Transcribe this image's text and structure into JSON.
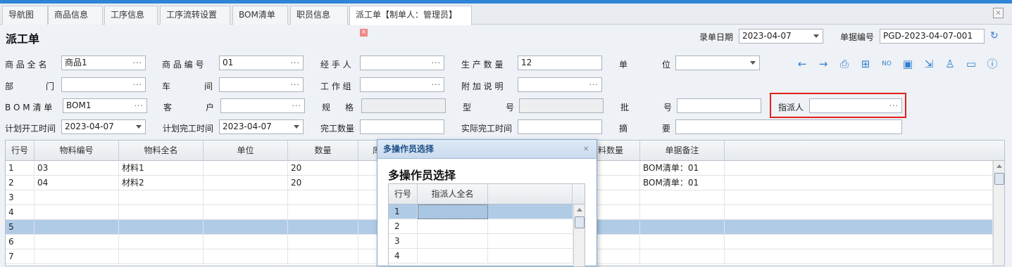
{
  "tabs": [
    {
      "label": "导航图"
    },
    {
      "label": "商品信息"
    },
    {
      "label": "工序信息"
    },
    {
      "label": "工序流转设置"
    },
    {
      "label": "BOM清单"
    },
    {
      "label": "职员信息"
    },
    {
      "label": "派工单【制单人：管理员】"
    }
  ],
  "page_title": "派工单",
  "header": {
    "date_label": "录单日期",
    "date_value": "2023-04-07",
    "doc_no_label": "单据编号",
    "doc_no_value": "PGD-2023-04-07-001"
  },
  "form": {
    "product_name_label": "商 品 全 名",
    "product_name_value": "商品1",
    "product_code_label": "商 品 编 号",
    "product_code_value": "01",
    "handler_label": "经 手 人",
    "handler_value": "",
    "qty_label": "生 产 数 量",
    "qty_value": "12",
    "unit_label_a": "单",
    "unit_label_b": "位",
    "unit_value": "",
    "dept_label_a": "部",
    "dept_label_b": "门",
    "dept_value": "",
    "workshop_label_a": "车",
    "workshop_label_b": "间",
    "workshop_value": "",
    "workgroup_label": "工 作 组",
    "workgroup_value": "",
    "note_label": "附 加 说 明",
    "note_value": "",
    "bom_label": "B O M 清 单",
    "bom_value": "BOM1",
    "customer_label_a": "客",
    "customer_label_b": "户",
    "customer_value": "",
    "spec_label_a": "规",
    "spec_label_b": "格",
    "spec_value": "",
    "model_label_a": "型",
    "model_label_b": "号",
    "model_value": "",
    "batch_label_a": "批",
    "batch_label_b": "号",
    "batch_value": "",
    "assigner_label": "指派人",
    "assigner_value": "",
    "plan_start_label": "计划开工时间",
    "plan_start_value": "2023-04-07",
    "plan_end_label": "计划完工时间",
    "plan_end_value": "2023-04-07",
    "done_qty_label": "完工数量",
    "done_qty_value": "",
    "actual_end_label": "实际完工时间",
    "actual_end_value": "",
    "summary_label_a": "摘",
    "summary_label_b": "要",
    "summary_value": ""
  },
  "toolbar": {
    "icons": [
      "arrow-left-icon",
      "arrow-right-icon",
      "print-icon",
      "barcode-icon",
      "number-icon",
      "save-icon",
      "export-icon",
      "user-icon",
      "folder-icon",
      "help-icon"
    ]
  },
  "grid": {
    "columns": [
      "行号",
      "物料编号",
      "物料全名",
      "单位",
      "数量",
      "库",
      "",
      "",
      "料数量",
      "单据备注"
    ],
    "rows": [
      {
        "no": "1",
        "code": "03",
        "name": "材料1",
        "unit": "",
        "qty": "20",
        "remark": "BOM清单：01"
      },
      {
        "no": "2",
        "code": "04",
        "name": "材料2",
        "unit": "",
        "qty": "20",
        "remark": "BOM清单：01"
      },
      {
        "no": "3",
        "code": "",
        "name": "",
        "unit": "",
        "qty": "",
        "remark": ""
      },
      {
        "no": "4",
        "code": "",
        "name": "",
        "unit": "",
        "qty": "",
        "remark": ""
      },
      {
        "no": "5",
        "code": "",
        "name": "",
        "unit": "",
        "qty": "",
        "remark": ""
      },
      {
        "no": "6",
        "code": "",
        "name": "",
        "unit": "",
        "qty": "",
        "remark": ""
      },
      {
        "no": "7",
        "code": "",
        "name": "",
        "unit": "",
        "qty": "",
        "remark": ""
      }
    ]
  },
  "dialog": {
    "title": "多操作员选择",
    "heading": "多操作员选择",
    "columns": [
      "行号",
      "指派人全名",
      ""
    ],
    "rows": [
      "1",
      "2",
      "3",
      "4"
    ]
  }
}
